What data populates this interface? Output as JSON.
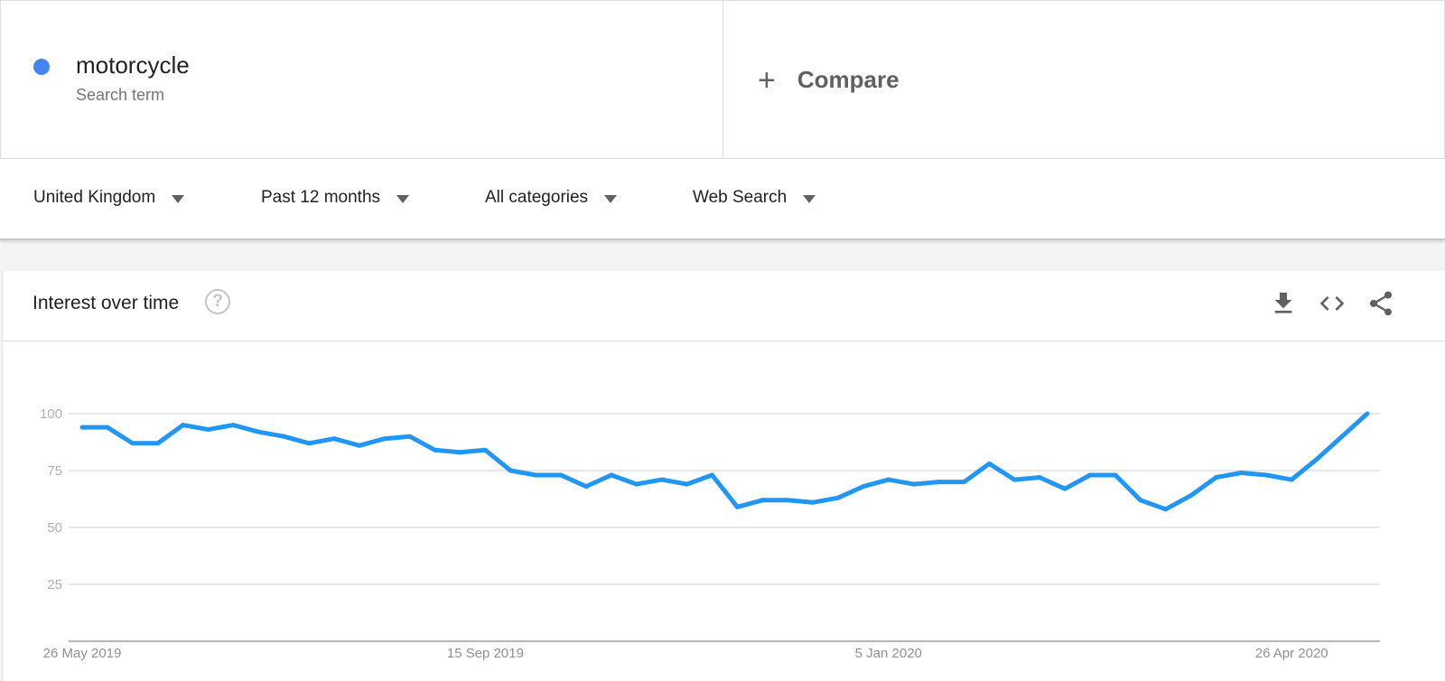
{
  "term": {
    "name": "motorcycle",
    "subtitle": "Search term",
    "color": "#4285f4"
  },
  "compare": {
    "icon": "plus-icon",
    "label": "Compare"
  },
  "filters": [
    {
      "label": "United Kingdom"
    },
    {
      "label": "Past 12 months"
    },
    {
      "label": "All categories"
    },
    {
      "label": "Web Search"
    }
  ],
  "card": {
    "title": "Interest over time",
    "help_icon": "help-circle-icon",
    "actions": [
      "download-icon",
      "embed-code-icon",
      "share-icon"
    ]
  },
  "chart_data": {
    "type": "line",
    "title": "Interest over time",
    "xlabel": "",
    "ylabel": "",
    "ylim": [
      0,
      100
    ],
    "yticks": [
      25,
      50,
      75,
      100
    ],
    "xtick_labels": [
      {
        "label": "26 May 2019",
        "index": 0
      },
      {
        "label": "15 Sep 2019",
        "index": 16
      },
      {
        "label": "5 Jan 2020",
        "index": 32
      },
      {
        "label": "26 Apr 2020",
        "index": 48
      }
    ],
    "grid": true,
    "legend": "none",
    "series": [
      {
        "name": "motorcycle",
        "color": "#2196f3",
        "values": [
          94,
          94,
          87,
          87,
          95,
          93,
          95,
          92,
          90,
          87,
          89,
          86,
          89,
          90,
          84,
          83,
          84,
          75,
          73,
          73,
          68,
          73,
          69,
          71,
          69,
          73,
          59,
          62,
          62,
          61,
          63,
          68,
          71,
          69,
          70,
          70,
          78,
          71,
          72,
          67,
          73,
          73,
          62,
          58,
          64,
          72,
          74,
          73,
          71,
          80,
          90,
          100
        ]
      }
    ]
  }
}
